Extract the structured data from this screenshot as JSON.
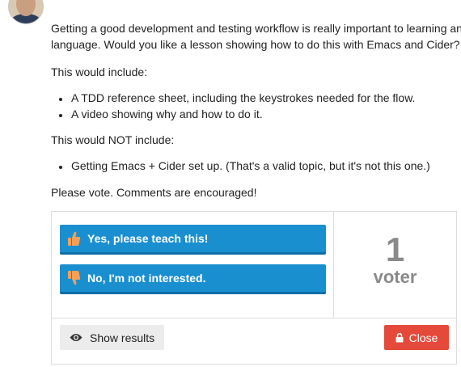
{
  "post": {
    "intro_line1": "Getting a good development and testing workflow is really important to learning an",
    "intro_line2": "language. Would you like a lesson showing how to do this with Emacs and Cider?",
    "include_heading": "This would include:",
    "include_items": [
      "A TDD reference sheet, including the keystrokes needed for the flow.",
      "A video showing why and how to do it."
    ],
    "exclude_heading": "This would NOT include:",
    "exclude_items": [
      "Getting Emacs + Cider set up. (That's a valid topic, but it's not this one.)"
    ],
    "vote_cta": "Please vote. Comments are encouraged!"
  },
  "poll": {
    "yes_label": "Yes, please teach this!",
    "no_label": "No, I'm not interested.",
    "voter_count": "1",
    "voter_unit": "voter",
    "show_results_label": "Show results",
    "close_label": "Close"
  },
  "colors": {
    "primary_blue": "#1a8fd0",
    "close_red": "#e5493a",
    "thumb_orange": "#f0a15a"
  },
  "icons": {
    "avatar": "user-avatar",
    "yes": "thumbs-up-icon",
    "no": "thumbs-down-icon",
    "results": "eye-icon",
    "close": "lock-icon"
  }
}
